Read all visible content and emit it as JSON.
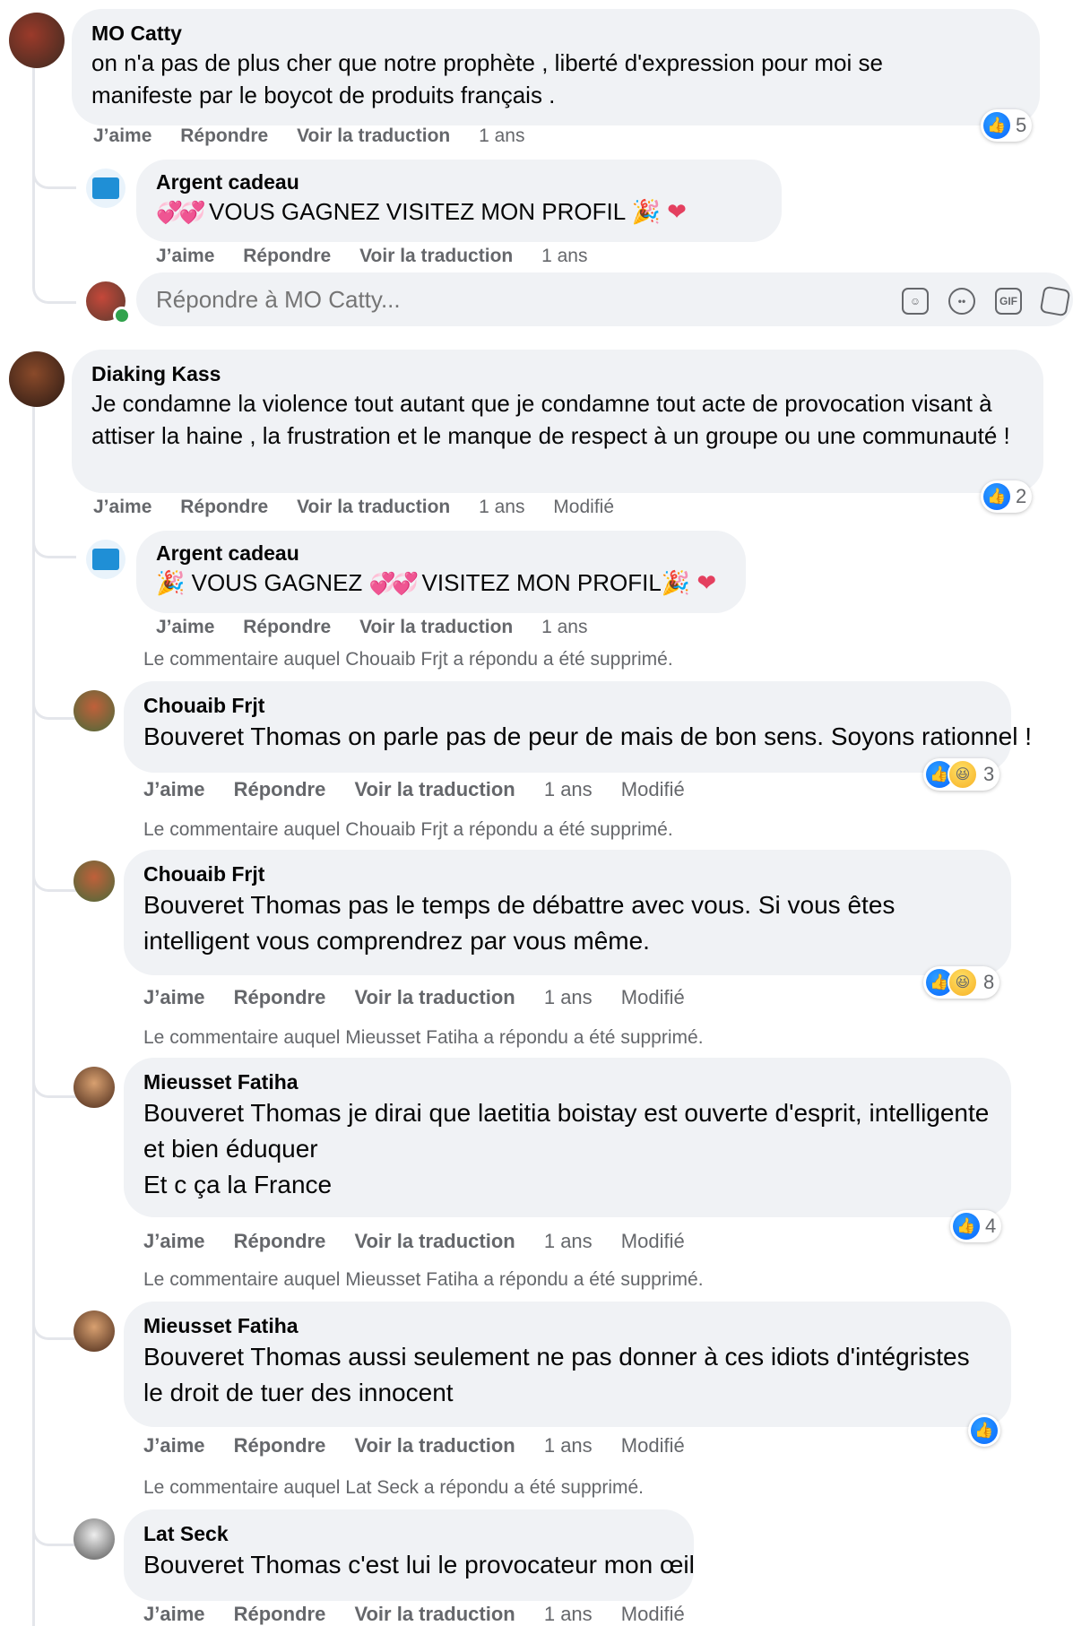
{
  "actions": {
    "like": "J’aime",
    "reply": "Répondre",
    "translate": "Voir la traduction",
    "edited": "Modifié"
  },
  "comments": [
    {
      "author": "MO Catty",
      "text": "on n'a pas de plus cher que notre prophète , liberté d'expression pour moi se manifeste par le boycot de produits français .",
      "time": "1 ans",
      "reactions": "5"
    },
    {
      "author": "Argent cadeau",
      "text": "VOUS GAGNEZ  VISITEZ MON PROFIL",
      "time": "1 ans"
    },
    {
      "author": "Diaking Kass",
      "text": "Je condamne la violence tout autant que je condamne tout acte de provocation visant à attiser la haine , la frustration et le manque de respect à un groupe ou une communauté !",
      "time": "1 ans",
      "reactions": "2"
    },
    {
      "author": "Argent cadeau",
      "text_a": "VOUS GAGNEZ",
      "text_b": "VISITEZ MON PROFIL",
      "time": "1 ans"
    },
    {
      "author": "Chouaib Frjt",
      "deleted_note": "Le commentaire auquel Chouaib Frjt a répondu a été supprimé.",
      "text": "Bouveret Thomas on parle pas de peur de mais de bon sens. Soyons rationnel !",
      "time": "1 ans",
      "reactions": "3"
    },
    {
      "author": "Chouaib Frjt",
      "deleted_note": "Le commentaire auquel Chouaib Frjt a répondu a été supprimé.",
      "text": "Bouveret Thomas pas le temps de débattre avec vous. Si vous êtes intelligent vous comprendrez par vous même.",
      "time": "1 ans",
      "reactions": "8"
    },
    {
      "author": "Mieusset Fatiha",
      "deleted_note": "Le commentaire auquel Mieusset Fatiha a répondu a été supprimé.",
      "text_l1": "Bouveret Thomas je dirai que laetitia boistay est ouverte d'esprit, intelligente",
      "text_l2": "et bien éduquer",
      "text_l3": "Et c ça la France",
      "time": "1 ans",
      "reactions": "4"
    },
    {
      "author": "Mieusset Fatiha",
      "deleted_note": "Le commentaire auquel Mieusset Fatiha a répondu a été supprimé.",
      "text": "Bouveret Thomas aussi seulement ne pas donner à ces idiots d'intégristes le droit de tuer des innocent",
      "time": "1 ans"
    },
    {
      "author": "Lat Seck",
      "deleted_note": "Le commentaire auquel Lat Seck a répondu a été supprimé.",
      "text": "Bouveret Thomas c'est lui le provocateur mon œil",
      "time": "1 ans"
    }
  ],
  "reply_box": {
    "placeholder": "Répondre à MO Catty..."
  },
  "icons": {
    "like": "like-icon",
    "haha": "haha-icon",
    "sticker": "sticker-icon",
    "emoji": "emoji-icon",
    "gif": "gif-icon",
    "label_gif": "GIF"
  },
  "colors": {
    "bubble": "#f0f2f5",
    "meta": "#65676b",
    "like_blue": "#0866ff"
  }
}
